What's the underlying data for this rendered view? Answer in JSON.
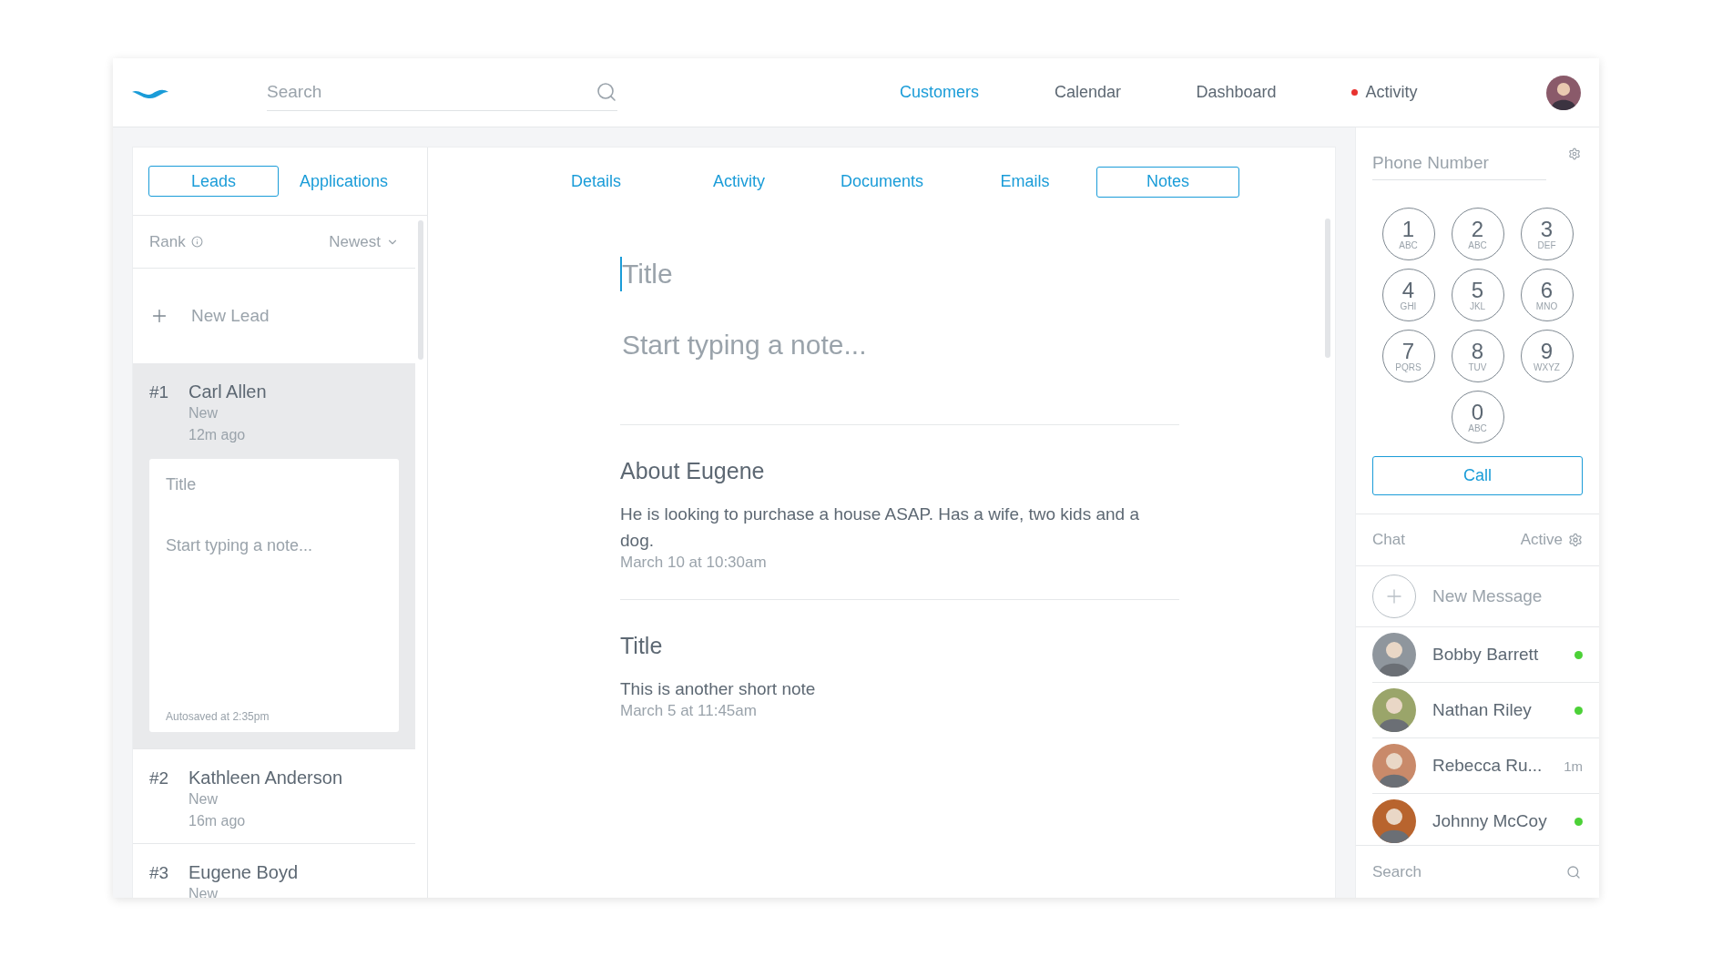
{
  "header": {
    "search": {
      "placeholder": "Search"
    },
    "nav": [
      {
        "label": "Customers",
        "selected": true,
        "alert": false
      },
      {
        "label": "Calendar",
        "selected": false,
        "alert": false
      },
      {
        "label": "Dashboard",
        "selected": false,
        "alert": false
      },
      {
        "label": "Activity",
        "selected": false,
        "alert": true
      }
    ]
  },
  "leads_panel": {
    "tabs": [
      {
        "label": "Leads",
        "selected": true
      },
      {
        "label": "Applications",
        "selected": false
      }
    ],
    "sort": {
      "label": "Rank",
      "order": "Newest"
    },
    "new_lead": "New Lead",
    "leads": [
      {
        "rank": "#1",
        "name": "Carl Allen",
        "status": "New",
        "time": "12m ago",
        "selected": true,
        "note": {
          "title_placeholder": "Title",
          "body_placeholder": "Start typing a note...",
          "autosave": "Autosaved at 2:35pm"
        }
      },
      {
        "rank": "#2",
        "name": "Kathleen Anderson",
        "status": "New",
        "time": "16m ago",
        "selected": false
      },
      {
        "rank": "#3",
        "name": "Eugene Boyd",
        "status": "New",
        "selected": false
      }
    ]
  },
  "detail": {
    "tabs": [
      {
        "label": "Details",
        "selected": false
      },
      {
        "label": "Activity",
        "selected": false
      },
      {
        "label": "Documents",
        "selected": false
      },
      {
        "label": "Emails",
        "selected": false
      },
      {
        "label": "Notes",
        "selected": true
      }
    ],
    "editor": {
      "title_placeholder": "Title",
      "body_placeholder": "Start typing a note...",
      "focused": true
    },
    "notes": [
      {
        "title": "About Eugene",
        "body": "He is looking to purchase a house ASAP. Has a wife, two kids and a dog.",
        "date": "March 10 at 10:30am"
      },
      {
        "title": "Title",
        "body": "This is another short note",
        "date": "March 5 at 11:45am"
      }
    ]
  },
  "phone": {
    "placeholder": "Phone Number",
    "keypad": [
      [
        {
          "digit": "1",
          "letters": "ABC"
        },
        {
          "digit": "2",
          "letters": "ABC"
        },
        {
          "digit": "3",
          "letters": "DEF"
        }
      ],
      [
        {
          "digit": "4",
          "letters": "GHI"
        },
        {
          "digit": "5",
          "letters": "JKL"
        },
        {
          "digit": "6",
          "letters": "MNO"
        }
      ],
      [
        {
          "digit": "7",
          "letters": "PQRS"
        },
        {
          "digit": "8",
          "letters": "TUV"
        },
        {
          "digit": "9",
          "letters": "WXYZ"
        }
      ],
      [
        {
          "digit": "0",
          "letters": "ABC"
        }
      ]
    ],
    "call": "Call"
  },
  "chat": {
    "title": "Chat",
    "status": "Active",
    "new_message": "New Message",
    "contacts": [
      {
        "name": "Bobby Barrett",
        "online": true
      },
      {
        "name": "Nathan Riley",
        "online": true
      },
      {
        "name": "Rebecca Ru...",
        "online": false,
        "time": "1m"
      },
      {
        "name": "Johnny McCoy",
        "online": true
      }
    ],
    "search": {
      "placeholder": "Search"
    }
  }
}
